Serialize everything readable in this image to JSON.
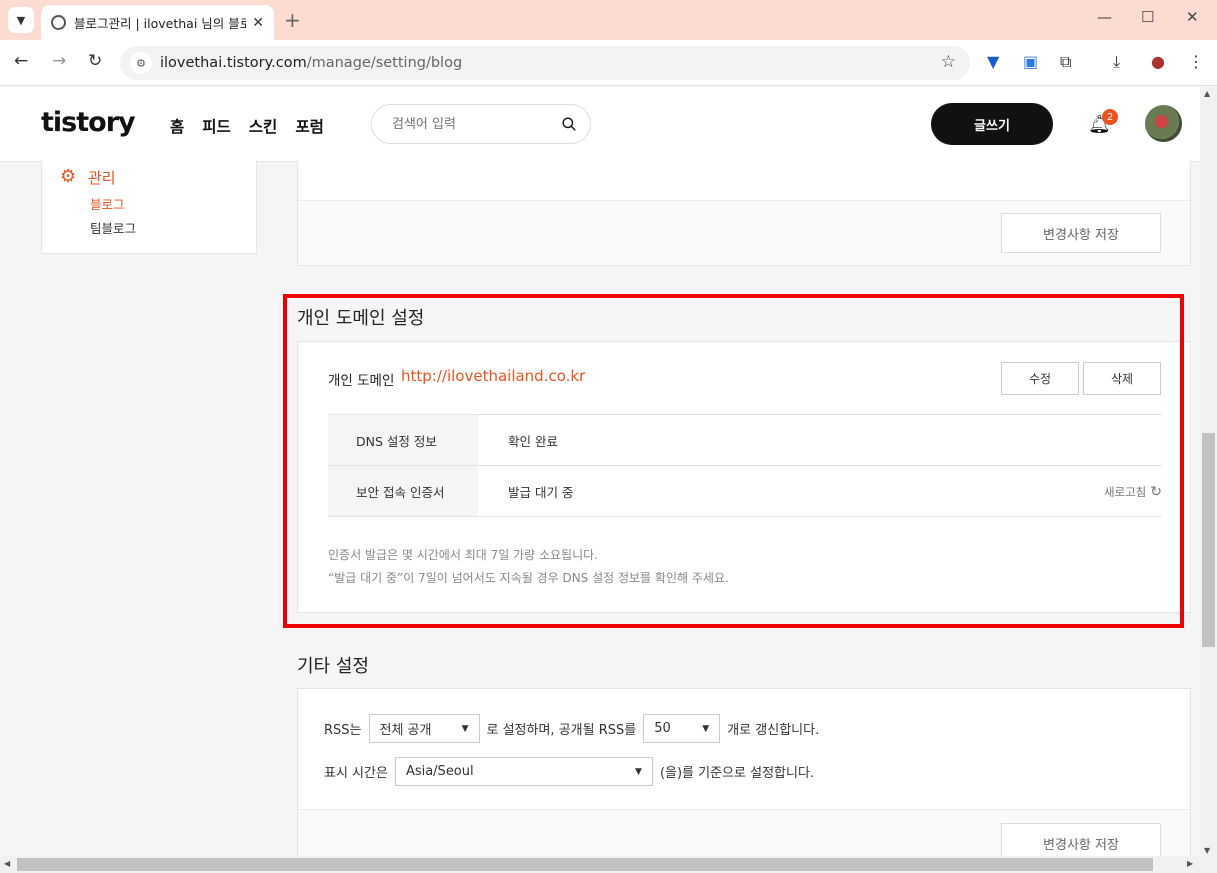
{
  "browser": {
    "tab_title": "블로그관리 | ilovethai 님의 블로그",
    "tab_list_icon": "chevron-down-icon",
    "new_tab": "+",
    "url_host": "ilovethai.tistory.com",
    "url_path": "/manage/setting/blog"
  },
  "header": {
    "logo": "tistory",
    "nav": [
      "홈",
      "피드",
      "스킨",
      "포럼"
    ],
    "search_placeholder": "검색어 입력",
    "write_button": "글쓰기",
    "notification_count": "2"
  },
  "sidebar": {
    "title": "관리",
    "items": [
      "블로그",
      "팀블로그"
    ]
  },
  "top_section": {
    "save_button": "변경사항 저장"
  },
  "domain_section": {
    "title": "개인 도메인 설정",
    "domain_label": "개인 도메인",
    "domain_value": "http://ilovethailand.co.kr",
    "edit_button": "수정",
    "delete_button": "삭제",
    "rows": [
      {
        "label": "DNS 설정 정보",
        "value": "확인 완료"
      },
      {
        "label": "보안 접속 인증서",
        "value": "발급 대기 중"
      }
    ],
    "refresh_label": "새로고침",
    "note1": "인증서 발급은 몇 시간에서 최대 7일 가량 소요됩니다.",
    "note2": "“발급 대기 중”이 7일이 넘어서도 지속될 경우 DNS 설정 정보를 확인해 주세요."
  },
  "etc_section": {
    "title": "기타 설정",
    "rss_prefix": "RSS는",
    "rss_select": "전체 공개",
    "rss_middle": "로 설정하며, 공개될 RSS를",
    "rss_count": "50",
    "rss_suffix": "개로 갱신합니다.",
    "tz_prefix": "표시 시간은",
    "tz_select": "Asia/Seoul",
    "tz_suffix": "(을)를 기준으로 설정합니다.",
    "save_button": "변경사항 저장"
  },
  "colors": {
    "accent": "#eb531f",
    "highlight": "#ee0000",
    "tab_bar": "#fcdcd0"
  }
}
